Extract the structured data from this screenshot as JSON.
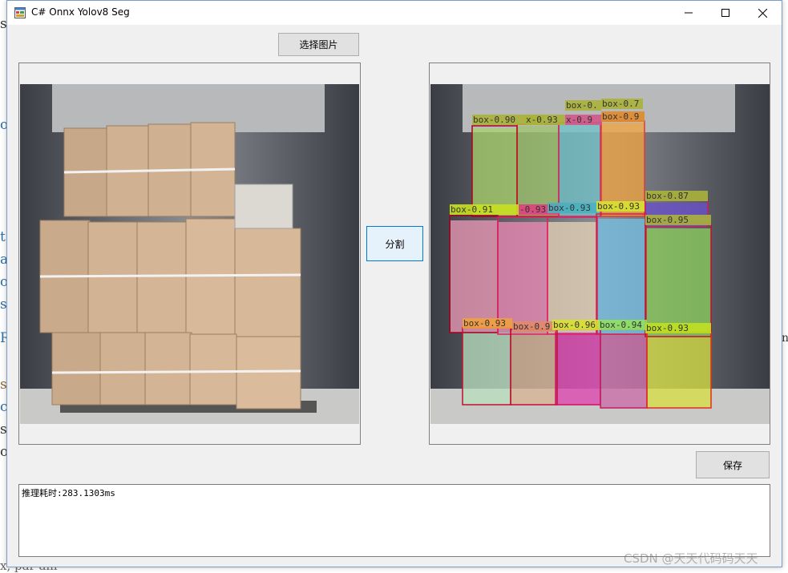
{
  "window": {
    "title": "C# Onnx Yolov8 Seg",
    "controls": [
      "minimize",
      "maximize",
      "close"
    ]
  },
  "buttons": {
    "select_image": "选择图片",
    "segment": "分割",
    "save": "保存"
  },
  "panels": {
    "left": {
      "content": "original-image",
      "icon": "photo-cargo-boxes"
    },
    "right": {
      "content": "segmented-image",
      "icon": "photo-cargo-boxes-masked"
    }
  },
  "detections": [
    {
      "label": "box-0.90",
      "color": "#aab23a"
    },
    {
      "label": "x-0.93",
      "color": "#aab23a"
    },
    {
      "label": "x-0.9",
      "color": "#d2588a"
    },
    {
      "label": "box-0.",
      "color": "#aab23a"
    },
    {
      "label": "box-0.7",
      "color": "#aab23a"
    },
    {
      "label": "box-0.9",
      "color": "#e08a2a"
    },
    {
      "label": "box-0.87",
      "color": "#aab23a"
    },
    {
      "label": "box-0.91",
      "color": "#c8e020"
    },
    {
      "label": "-0.93",
      "color": "#e04080"
    },
    {
      "label": "box-0.93",
      "color": "#4ab0c0"
    },
    {
      "label": "box-0.93",
      "color": "#d8e030"
    },
    {
      "label": "box-0.95",
      "color": "#aab23a"
    },
    {
      "label": "box-0.93",
      "color": "#f0a040"
    },
    {
      "label": "box-0.9",
      "color": "#e08a6a"
    },
    {
      "label": "box-0.96",
      "color": "#d8e030"
    },
    {
      "label": "box-0.94",
      "color": "#90e060"
    },
    {
      "label": "box-0.93",
      "color": "#c0e020"
    }
  ],
  "log": {
    "text": "推理耗时:283.1303ms"
  },
  "background": {
    "letters": [
      "s",
      "o",
      "t",
      "a",
      "o",
      "s",
      "R",
      "s",
      "c",
      "s",
      "o",
      "ne"
    ],
    "bottom_text": "x, par am",
    "watermark": "CSDN @天天代码码天天"
  },
  "colors": {
    "window_bg": "#f0f0f0",
    "focus_border": "#0078d7",
    "button_bg": "#e1e1e1"
  }
}
